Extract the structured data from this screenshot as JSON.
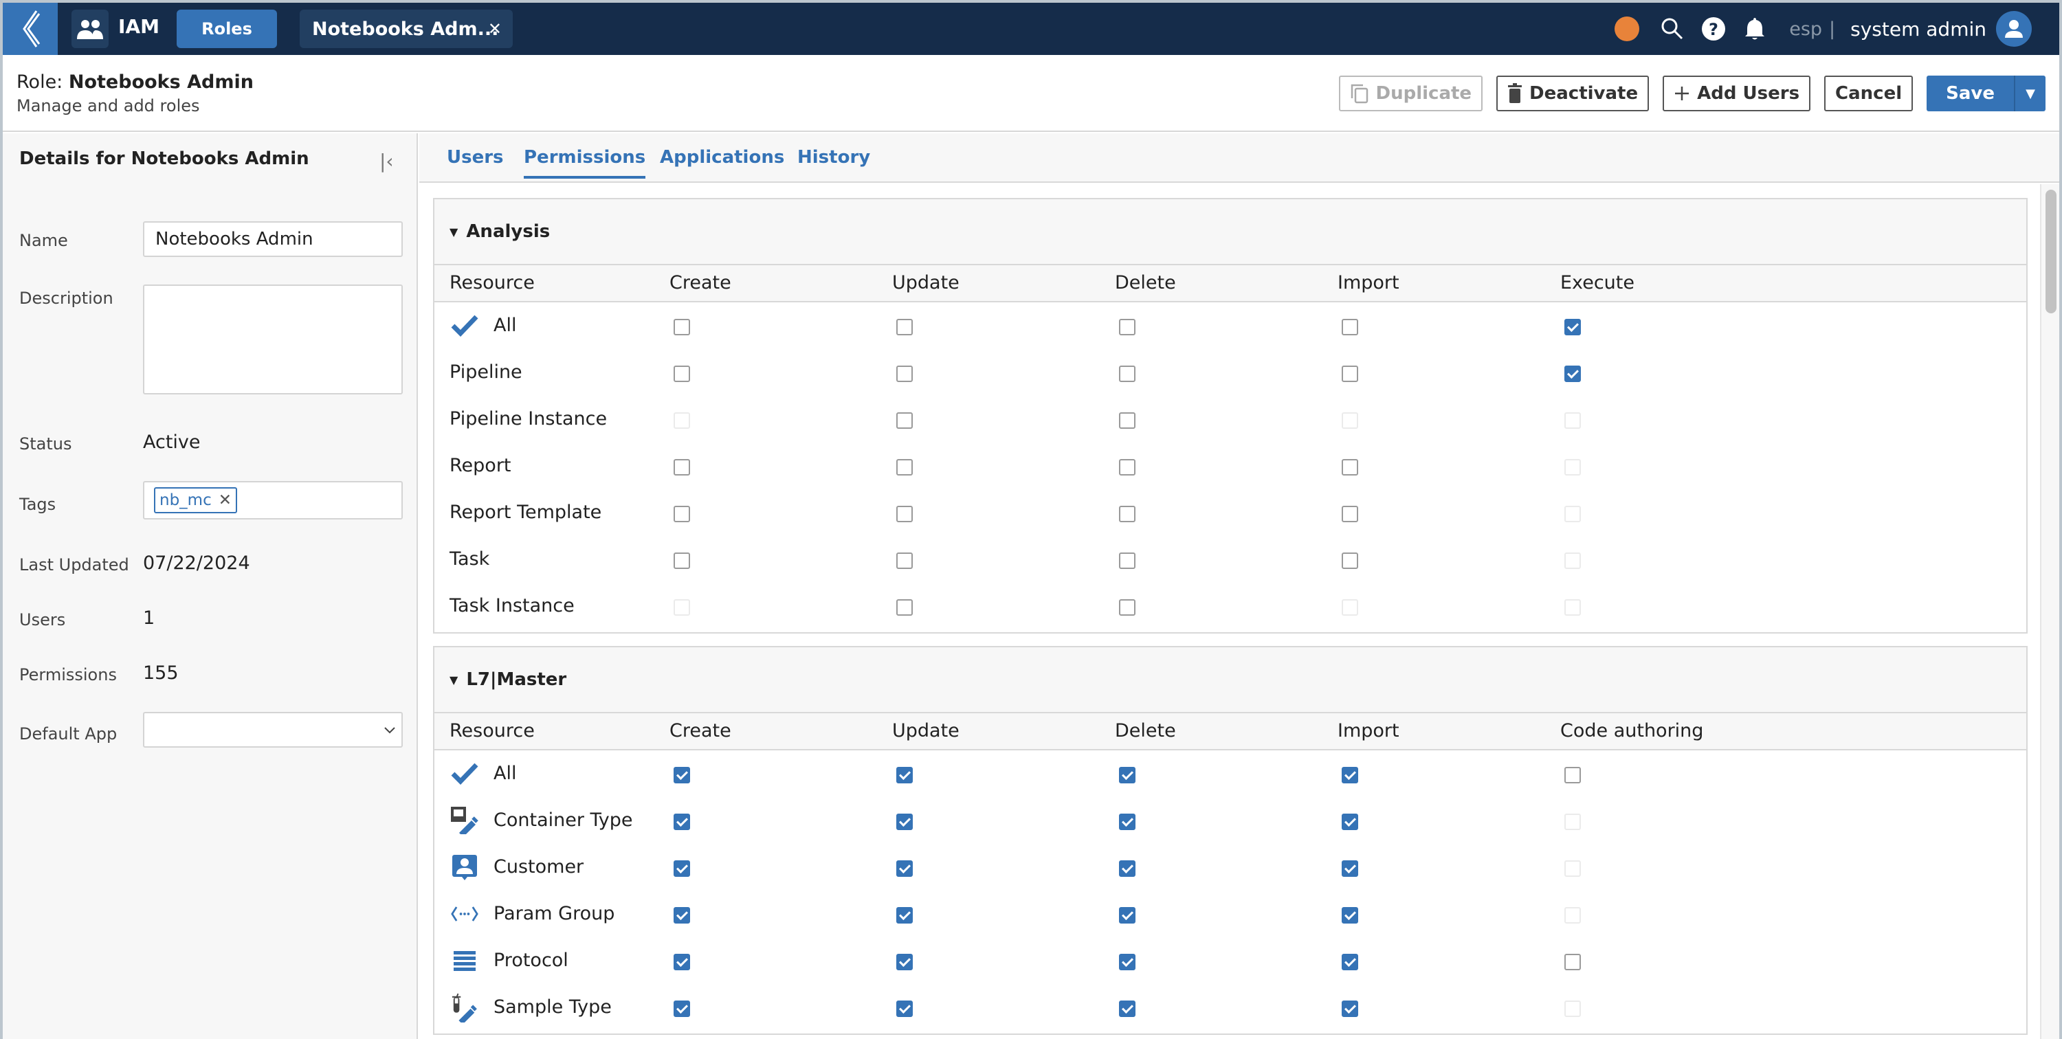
{
  "topbar": {
    "app_name": "IAM",
    "active_module": "Roles",
    "open_tab": "Notebooks Adm...",
    "status_color": "#e8833a",
    "tenant": "esp",
    "separator": "|",
    "user_name": "system admin"
  },
  "header": {
    "title_prefix": "Role:",
    "title_name": "Notebooks Admin",
    "subtitle": "Manage and add roles",
    "buttons": {
      "duplicate": "Duplicate",
      "deactivate": "Deactivate",
      "add_users": "Add Users",
      "cancel": "Cancel",
      "save": "Save"
    }
  },
  "details": {
    "title": "Details for Notebooks Admin",
    "fields": {
      "name_label": "Name",
      "name_value": "Notebooks Admin",
      "description_label": "Description",
      "description_value": "",
      "status_label": "Status",
      "status_value": "Active",
      "tags_label": "Tags",
      "tags": [
        "nb_mc"
      ],
      "last_updated_label": "Last Updated",
      "last_updated_value": "07/22/2024",
      "users_label": "Users",
      "users_value": "1",
      "permissions_label": "Permissions",
      "permissions_value": "155",
      "default_app_label": "Default App",
      "default_app_value": ""
    }
  },
  "tabs": [
    "Users",
    "Permissions",
    "Applications",
    "History"
  ],
  "active_tab": "Permissions",
  "sections": [
    {
      "name": "Analysis",
      "columns": [
        "Resource",
        "Create",
        "Update",
        "Delete",
        "Import",
        "Execute"
      ],
      "rows": [
        {
          "resource": "All",
          "icon": "check-icon",
          "states": [
            "unchecked",
            "unchecked",
            "unchecked",
            "unchecked",
            "checked"
          ]
        },
        {
          "resource": "Pipeline",
          "icon": "",
          "states": [
            "unchecked",
            "unchecked",
            "unchecked",
            "unchecked",
            "checked"
          ]
        },
        {
          "resource": "Pipeline Instance",
          "icon": "",
          "states": [
            "disabled",
            "unchecked",
            "unchecked",
            "disabled",
            "disabled"
          ]
        },
        {
          "resource": "Report",
          "icon": "",
          "states": [
            "unchecked",
            "unchecked",
            "unchecked",
            "unchecked",
            "disabled"
          ]
        },
        {
          "resource": "Report Template",
          "icon": "",
          "states": [
            "unchecked",
            "unchecked",
            "unchecked",
            "unchecked",
            "disabled"
          ]
        },
        {
          "resource": "Task",
          "icon": "",
          "states": [
            "unchecked",
            "unchecked",
            "unchecked",
            "unchecked",
            "disabled"
          ]
        },
        {
          "resource": "Task Instance",
          "icon": "",
          "states": [
            "disabled",
            "unchecked",
            "unchecked",
            "disabled",
            "disabled"
          ]
        }
      ]
    },
    {
      "name": "L7|Master",
      "columns": [
        "Resource",
        "Create",
        "Update",
        "Delete",
        "Import",
        "Code authoring"
      ],
      "rows": [
        {
          "resource": "All",
          "icon": "check-icon",
          "states": [
            "checked",
            "checked",
            "checked",
            "checked",
            "unchecked"
          ]
        },
        {
          "resource": "Container Type",
          "icon": "container-type-icon",
          "states": [
            "checked",
            "checked",
            "checked",
            "checked",
            "disabled"
          ]
        },
        {
          "resource": "Customer",
          "icon": "customer-icon",
          "states": [
            "checked",
            "checked",
            "checked",
            "checked",
            "disabled"
          ]
        },
        {
          "resource": "Param Group",
          "icon": "param-group-icon",
          "states": [
            "checked",
            "checked",
            "checked",
            "checked",
            "disabled"
          ]
        },
        {
          "resource": "Protocol",
          "icon": "protocol-icon",
          "states": [
            "checked",
            "checked",
            "checked",
            "checked",
            "unchecked"
          ]
        },
        {
          "resource": "Sample Type",
          "icon": "sample-type-icon",
          "states": [
            "checked",
            "checked",
            "checked",
            "checked",
            "disabled"
          ]
        }
      ]
    }
  ],
  "colors": {
    "topbar": "#152c4a",
    "accent": "#3573b6",
    "status_dot": "#e8833a"
  }
}
